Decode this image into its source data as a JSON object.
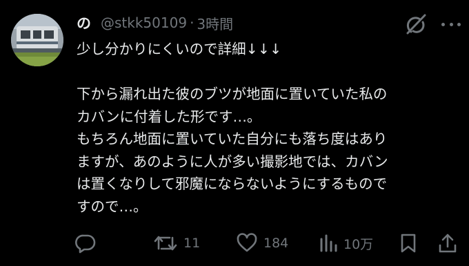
{
  "post": {
    "display_name": "の",
    "handle": "@stkk50109",
    "separator": "·",
    "timestamp": "3時間",
    "lines": [
      "少し分かりにくいので詳細↓↓↓",
      "",
      "下から漏れ出た彼のブツが地面に置いていた私の",
      "カバンに付着した形です…。",
      "もちろん地面に置いていた自分にも落ち度はあり",
      "ますが、あのように人が多い撮影地では、カバン",
      "は置くなりして邪魔にならないようにするもので",
      "すので…。"
    ]
  },
  "actions": {
    "reply_icon": "reply-icon",
    "repost_icon": "repost-icon",
    "repost_count": "11",
    "like_icon": "heart-icon",
    "like_count": "184",
    "views_icon": "views-icon",
    "views_count": "10万",
    "bookmark_icon": "bookmark-icon",
    "share_icon": "share-icon"
  },
  "colors": {
    "background": "#000000",
    "text": "#e7e9ea",
    "muted": "#71767b"
  }
}
